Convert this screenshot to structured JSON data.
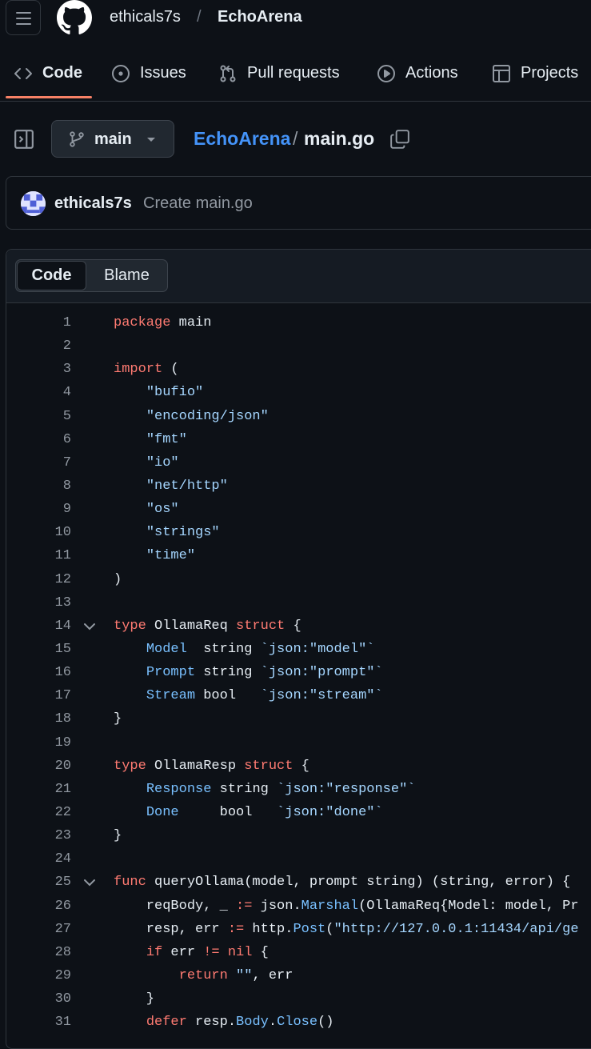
{
  "header": {
    "owner": "ethicals7s",
    "separator": "/",
    "repo": "EchoArena"
  },
  "tabs": [
    {
      "label": "Code",
      "icon": "code-icon",
      "selected": true
    },
    {
      "label": "Issues",
      "icon": "issue-opened-icon"
    },
    {
      "label": "Pull requests",
      "icon": "git-pull-request-icon"
    },
    {
      "label": "Actions",
      "icon": "play-icon"
    },
    {
      "label": "Projects",
      "icon": "table-icon"
    }
  ],
  "file_nav": {
    "branch": "main",
    "path_repo": "EchoArena",
    "path_separator": "/",
    "path_file": "main.go"
  },
  "commit": {
    "author": "ethicals7s",
    "message": "Create main.go"
  },
  "view_toggle": {
    "code_label": "Code",
    "blame_label": "Blame"
  },
  "colors": {
    "accent_underline": "#f78166",
    "link": "#4493f8",
    "keyword": "#ff7b72",
    "string": "#a5d6ff",
    "field": "#79c0ff"
  },
  "code": [
    {
      "n": "1",
      "parts": [
        [
          "k",
          "package"
        ],
        [
          "",
          "main"
        ]
      ]
    },
    {
      "n": "2",
      "parts": []
    },
    {
      "n": "3",
      "parts": [
        [
          "k",
          "import"
        ],
        [
          "",
          " ("
        ]
      ]
    },
    {
      "n": "4",
      "parts": [
        [
          "",
          "    "
        ],
        [
          "s",
          "\"bufio\""
        ]
      ]
    },
    {
      "n": "5",
      "parts": [
        [
          "",
          "    "
        ],
        [
          "s",
          "\"encoding/json\""
        ]
      ]
    },
    {
      "n": "6",
      "parts": [
        [
          "",
          "    "
        ],
        [
          "s",
          "\"fmt\""
        ]
      ]
    },
    {
      "n": "7",
      "parts": [
        [
          "",
          "    "
        ],
        [
          "s",
          "\"io\""
        ]
      ]
    },
    {
      "n": "8",
      "parts": [
        [
          "",
          "    "
        ],
        [
          "s",
          "\"net/http\""
        ]
      ]
    },
    {
      "n": "9",
      "parts": [
        [
          "",
          "    "
        ],
        [
          "s",
          "\"os\""
        ]
      ]
    },
    {
      "n": "10",
      "parts": [
        [
          "",
          "    "
        ],
        [
          "s",
          "\"strings\""
        ]
      ]
    },
    {
      "n": "11",
      "parts": [
        [
          "",
          "    "
        ],
        [
          "s",
          "\"time\""
        ]
      ]
    },
    {
      "n": "12",
      "parts": [
        [
          "",
          ")"
        ]
      ]
    },
    {
      "n": "13",
      "parts": []
    },
    {
      "n": "14",
      "fold": true,
      "parts": [
        [
          "k",
          "type"
        ],
        [
          "",
          " OllamaReq "
        ],
        [
          "k",
          "struct"
        ],
        [
          "",
          " {"
        ]
      ]
    },
    {
      "n": "15",
      "parts": [
        [
          "",
          "    "
        ],
        [
          "f",
          "Model"
        ],
        [
          "",
          "  string "
        ],
        [
          "s",
          "`json:\"model\"`"
        ]
      ]
    },
    {
      "n": "16",
      "parts": [
        [
          "",
          "    "
        ],
        [
          "f",
          "Prompt"
        ],
        [
          "",
          " string "
        ],
        [
          "s",
          "`json:\"prompt\"`"
        ]
      ]
    },
    {
      "n": "17",
      "parts": [
        [
          "",
          "    "
        ],
        [
          "f",
          "Stream"
        ],
        [
          "",
          " bool   "
        ],
        [
          "s",
          "`json:\"stream\"`"
        ]
      ]
    },
    {
      "n": "18",
      "parts": [
        [
          "",
          "}"
        ]
      ]
    },
    {
      "n": "19",
      "parts": []
    },
    {
      "n": "20",
      "parts": [
        [
          "k",
          "type"
        ],
        [
          "",
          " OllamaResp "
        ],
        [
          "k",
          "struct"
        ],
        [
          "",
          " {"
        ]
      ]
    },
    {
      "n": "21",
      "parts": [
        [
          "",
          "    "
        ],
        [
          "f",
          "Response"
        ],
        [
          "",
          " string "
        ],
        [
          "s",
          "`json:\"response\"`"
        ]
      ]
    },
    {
      "n": "22",
      "parts": [
        [
          "",
          "    "
        ],
        [
          "f",
          "Done"
        ],
        [
          "",
          "     bool   "
        ],
        [
          "s",
          "`json:\"done\"`"
        ]
      ]
    },
    {
      "n": "23",
      "parts": [
        [
          "",
          "}"
        ]
      ]
    },
    {
      "n": "24",
      "parts": []
    },
    {
      "n": "25",
      "fold": true,
      "parts": [
        [
          "k",
          "func"
        ],
        [
          "",
          " queryOllama(model, prompt string) (string, error) {"
        ]
      ]
    },
    {
      "n": "26",
      "parts": [
        [
          "",
          "    reqBody, _ "
        ],
        [
          "k",
          ":="
        ],
        [
          "",
          " json."
        ],
        [
          "f",
          "Marshal"
        ],
        [
          "",
          "(OllamaReq{Model: model, Pr"
        ]
      ]
    },
    {
      "n": "27",
      "parts": [
        [
          "",
          "    resp, err "
        ],
        [
          "k",
          ":="
        ],
        [
          "",
          " http."
        ],
        [
          "f",
          "Post"
        ],
        [
          "",
          "("
        ],
        [
          "s",
          "\"http://127.0.0.1:11434/api/ge"
        ]
      ]
    },
    {
      "n": "28",
      "parts": [
        [
          "",
          "    "
        ],
        [
          "k",
          "if"
        ],
        [
          "",
          " err "
        ],
        [
          "k",
          "!="
        ],
        [
          "",
          " "
        ],
        [
          "k",
          "nil"
        ],
        [
          "",
          " {"
        ]
      ]
    },
    {
      "n": "29",
      "parts": [
        [
          "",
          "        "
        ],
        [
          "k",
          "return"
        ],
        [
          "",
          " "
        ],
        [
          "s",
          "\"\""
        ],
        [
          "",
          ", err"
        ]
      ]
    },
    {
      "n": "30",
      "parts": [
        [
          "",
          "    }"
        ]
      ]
    },
    {
      "n": "31",
      "parts": [
        [
          "",
          "    "
        ],
        [
          "k",
          "defer"
        ],
        [
          "",
          " resp."
        ],
        [
          "f",
          "Body"
        ],
        [
          "",
          "."
        ],
        [
          "f",
          "Close"
        ],
        [
          "",
          "()"
        ]
      ]
    }
  ]
}
